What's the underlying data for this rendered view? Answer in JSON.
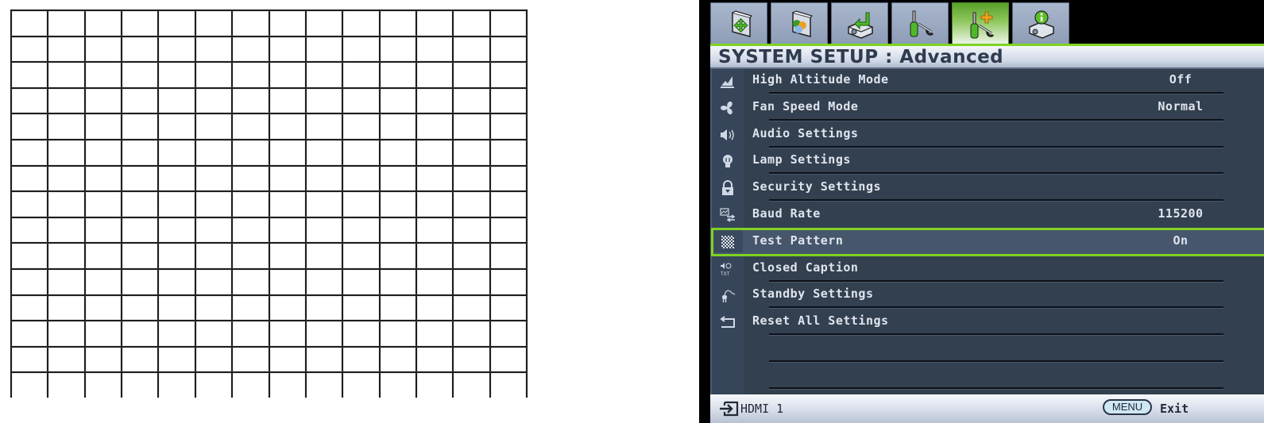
{
  "test_pattern": {
    "columns": 14,
    "rows": 15,
    "line_color": "#1e1e1e",
    "background": "#ffffff"
  },
  "osd": {
    "tabs": [
      {
        "name": "picture",
        "icon": "display-move-icon",
        "active": false
      },
      {
        "name": "picture-advanced",
        "icon": "display-color-icon",
        "active": false
      },
      {
        "name": "source",
        "icon": "projector-input-icon",
        "active": false
      },
      {
        "name": "system-setup-basic",
        "icon": "tools-icon",
        "active": false
      },
      {
        "name": "system-setup-advanced",
        "icon": "tools-plus-icon",
        "active": true
      },
      {
        "name": "information",
        "icon": "projector-info-icon",
        "active": false
      }
    ],
    "header": {
      "title": "SYSTEM SETUP : Advanced"
    },
    "items": [
      {
        "icon": "altitude-icon",
        "label": "High Altitude Mode",
        "value": "Off"
      },
      {
        "icon": "fan-icon",
        "label": "Fan Speed Mode",
        "value": "Normal"
      },
      {
        "icon": "speaker-icon",
        "label": "Audio Settings",
        "value": ""
      },
      {
        "icon": "lamp-icon",
        "label": "Lamp Settings",
        "value": ""
      },
      {
        "icon": "lock-icon",
        "label": "Security Settings",
        "value": ""
      },
      {
        "icon": "baud-rate-icon",
        "label": "Baud Rate",
        "value": "115200"
      },
      {
        "icon": "test-pattern-icon",
        "label": "Test Pattern",
        "value": "On",
        "selected": true
      },
      {
        "icon": "closed-caption-icon",
        "label": "Closed Caption",
        "value": ""
      },
      {
        "icon": "standby-plug-icon",
        "label": "Standby Settings",
        "value": ""
      },
      {
        "icon": "reset-icon",
        "label": "Reset All Settings",
        "value": ""
      },
      {
        "icon": "",
        "label": "",
        "value": ""
      },
      {
        "icon": "",
        "label": "",
        "value": ""
      }
    ],
    "footer": {
      "source_icon": "input-source-icon",
      "source": "HDMI 1",
      "menu_key": "MENU",
      "exit_label": "Exit"
    },
    "colors": {
      "accent_green": "#7fd321",
      "menu_bg": "#33404f",
      "text": "#dfe5ee"
    }
  }
}
